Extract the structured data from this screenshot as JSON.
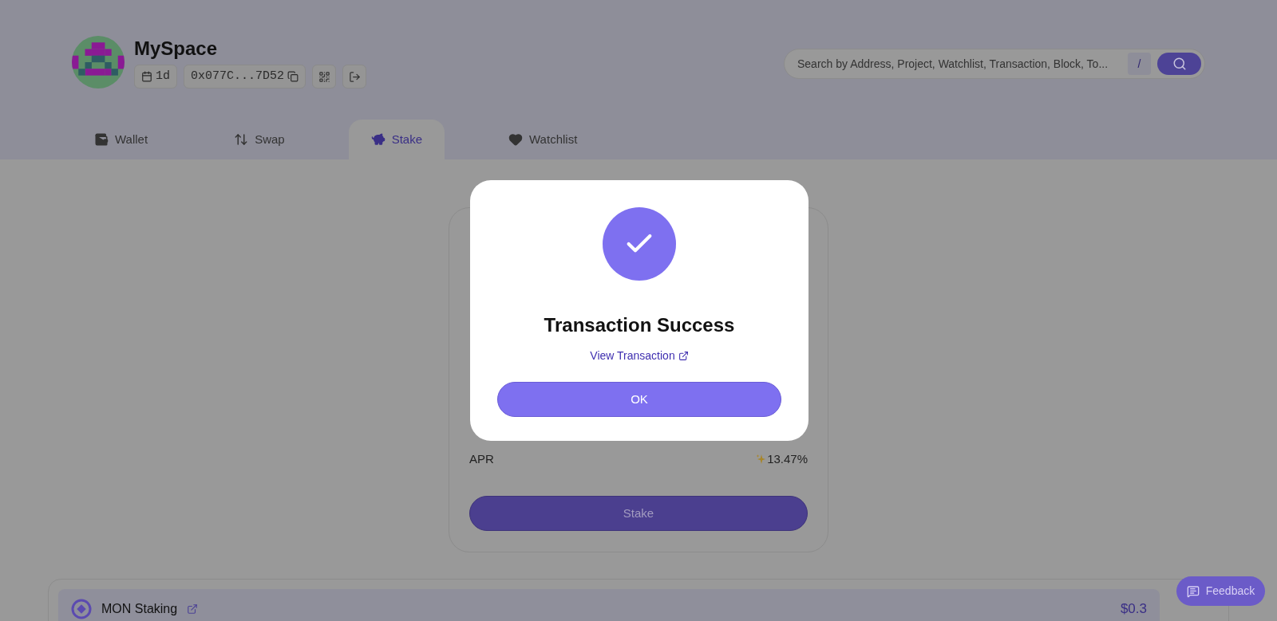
{
  "profile": {
    "name": "MySpace",
    "age_badge": "1d",
    "address": "0x077C...7D52"
  },
  "search": {
    "placeholder": "Search by Address, Project, Watchlist, Transaction, Block, To...",
    "shortcut": "/"
  },
  "tabs": [
    {
      "label": "Wallet",
      "selected": false
    },
    {
      "label": "Swap",
      "selected": false
    },
    {
      "label": "Stake",
      "selected": true
    },
    {
      "label": "Watchlist",
      "selected": false
    }
  ],
  "stake_card": {
    "rows": [
      {
        "label": "APR",
        "value": "13.47%",
        "sparkle": true
      }
    ],
    "button": "Stake"
  },
  "modal": {
    "title": "Transaction Success",
    "link": "View Transaction",
    "button": "OK"
  },
  "positions": [
    {
      "name": "MON Staking",
      "value": "$0.3"
    }
  ],
  "feedback": {
    "label": "Feedback"
  }
}
